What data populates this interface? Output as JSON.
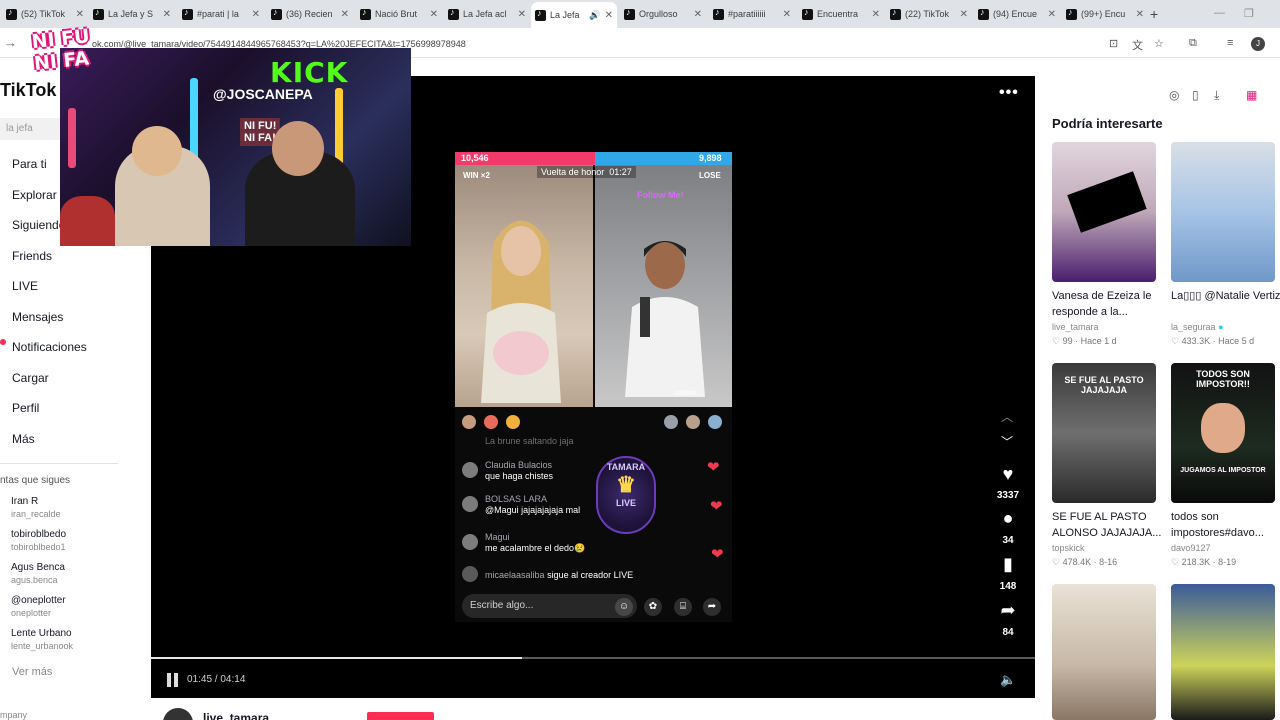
{
  "browser": {
    "tabs": [
      {
        "title": "(52) TikTok"
      },
      {
        "title": "La Jefa y S"
      },
      {
        "title": "#parati | la"
      },
      {
        "title": "(36) Recien"
      },
      {
        "title": "Nació Brut"
      },
      {
        "title": "La Jefa acl"
      },
      {
        "title": "La Jefa",
        "active": true,
        "audio": true
      },
      {
        "title": "Orgulloso"
      },
      {
        "title": "#paratiiiiii"
      },
      {
        "title": "Encuentra"
      },
      {
        "title": "(22) TikTok"
      },
      {
        "title": "(94) Encue"
      },
      {
        "title": "(99+) Encu"
      }
    ],
    "url": "ok.com/@live_tamara/video/7544914844965768453?q=LA%20JEFECITA&t=1756998978948"
  },
  "sidebar": {
    "logo": "TikTok",
    "search_placeholder": "la jefa",
    "nav": [
      {
        "label": "Para ti",
        "icon": "home-icon"
      },
      {
        "label": "Explorar",
        "icon": "compass-icon"
      },
      {
        "label": "Siguiendo",
        "icon": "following-icon"
      },
      {
        "label": "Friends",
        "icon": "friends-icon"
      },
      {
        "label": "LIVE",
        "icon": "live-icon"
      },
      {
        "label": "Mensajes",
        "icon": "message-icon"
      },
      {
        "label": "Notificaciones",
        "icon": "bell-icon"
      },
      {
        "label": "Cargar",
        "icon": "upload-icon"
      },
      {
        "label": "Perfil",
        "icon": "profile-icon"
      },
      {
        "label": "Más",
        "icon": "more-icon"
      }
    ],
    "following_title": "ntas que sigues",
    "accounts": [
      {
        "name": "Iran R",
        "handle": "iran_recalde"
      },
      {
        "name": "tobiroblbedo",
        "handle": "tobiroblbedo1"
      },
      {
        "name": "Agus Benca",
        "handle": "agus.benca"
      },
      {
        "name": "@oneplotter",
        "handle": "oneplotter"
      },
      {
        "name": "Lente Urbano",
        "handle": "lente_urbanook"
      }
    ],
    "ver_mas": "Ver más",
    "company": "mpany"
  },
  "overlay_stream": {
    "badge_line1": "NI FU",
    "badge_line2": "NI FA",
    "brand": "KICK",
    "handle": "@JOSCANEPA",
    "sign_line1": "NI FU!",
    "sign_line2": "NI FA!"
  },
  "video": {
    "pk_left_score": "10,546",
    "pk_right_score": "9,898",
    "win_label": "WIN ×2",
    "lose_label": "LOSE",
    "round_label": "Vuelta de honor",
    "round_time": "01:27",
    "follow_me": "Follow Me!",
    "pablito": "pablito...",
    "chat": [
      {
        "name": "La brune saltando jaja",
        "msg": ""
      },
      {
        "name": "Claudia Bulacios",
        "msg": "que haga chistes"
      },
      {
        "name": "BOLSAS LARA",
        "msg": "@Magui jajajajajaja mal"
      },
      {
        "name": "Magui",
        "msg": "me acalambre el dedo😢"
      },
      {
        "name": "micaelaasaliba",
        "msg": "sigue al creador LIVE"
      }
    ],
    "tamara_logo_line1": "TAMARA",
    "tamara_logo_line2": "LIVE",
    "chat_placeholder": "Escribe algo...",
    "time": "01:45 / 04:14",
    "progress": 0.42
  },
  "rail": {
    "likes": "3337",
    "comments": "34",
    "saves": "148",
    "shares": "84"
  },
  "recommendations": {
    "title": "Podría interesarte",
    "cards": [
      {
        "title": "Vanesa de Ezeiza le responde a la...",
        "author": "live_tamara",
        "likes": "99",
        "age": "Hace 1 d",
        "verified": false,
        "thumb_caption": ""
      },
      {
        "title": "La▯▯▯ @Natalie Vertiz",
        "author": "la_seguraa",
        "likes": "433.3K",
        "age": "Hace 5 d",
        "verified": true,
        "thumb_caption": ""
      },
      {
        "title": "SE FUE AL PASTO ALONSO JAJAJAJA...",
        "author": "topskick",
        "likes": "478.4K",
        "age": "8-16",
        "verified": false,
        "thumb_caption": "SE FUE AL PASTO JAJAJAJA"
      },
      {
        "title": "todos son impostores#davo...",
        "author": "davo9127",
        "likes": "218.3K",
        "age": "8-19",
        "verified": false,
        "thumb_caption": "TODOS SON IMPOSTOR!!"
      },
      {
        "title": "",
        "author": "",
        "likes": "",
        "age": "",
        "verified": false,
        "thumb_caption": ""
      },
      {
        "title": "",
        "author": "",
        "likes": "",
        "age": "",
        "verified": false,
        "thumb_caption": ""
      }
    ],
    "thumb3_sub": "JUGAMOS AL IMPOSTOR"
  },
  "bottom": {
    "username": "live_tamara"
  },
  "colors": {
    "accent": "#fe2c55",
    "pk_red": "#f23a6b",
    "pk_blue": "#2fa7e8",
    "kick_green": "#53fc18"
  }
}
